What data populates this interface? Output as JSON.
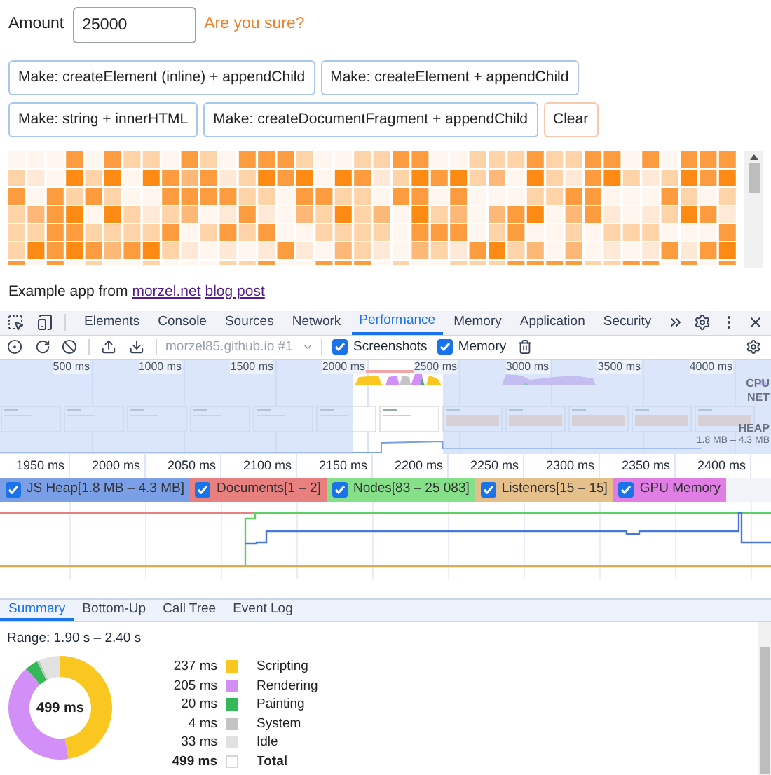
{
  "page": {
    "amount_label": "Amount",
    "amount_value": "25000",
    "warning": "Are you sure?",
    "buttons": [
      {
        "label": "Make: createElement (inline) + appendChild",
        "kind": "make"
      },
      {
        "label": "Make: createElement + appendChild",
        "kind": "make"
      },
      {
        "label": "Make: string + innerHTML",
        "kind": "make"
      },
      {
        "label": "Make: createDocumentFragment + appendChild",
        "kind": "make"
      },
      {
        "label": "Clear",
        "kind": "clear"
      }
    ],
    "footer": {
      "text": "Example app from",
      "links": [
        "morzel.net",
        "blog post"
      ]
    }
  },
  "devtools": {
    "tabs": [
      {
        "label": "Elements",
        "selected": false
      },
      {
        "label": "Console",
        "selected": false
      },
      {
        "label": "Sources",
        "selected": false
      },
      {
        "label": "Network",
        "selected": false
      },
      {
        "label": "Performance",
        "selected": true
      },
      {
        "label": "Memory",
        "selected": false
      },
      {
        "label": "Application",
        "selected": false
      },
      {
        "label": "Security",
        "selected": false
      }
    ],
    "toolbar": {
      "target": "morzel85.github.io #1",
      "checkboxes": [
        {
          "label": "Screenshots",
          "checked": true
        },
        {
          "label": "Memory",
          "checked": true
        }
      ]
    },
    "overview": {
      "ticks": [
        "500 ms",
        "1000 ms",
        "1500 ms",
        "2000 ms",
        "2500 ms",
        "3000 ms",
        "3500 ms",
        "4000 ms"
      ],
      "cpu_label": "CPU",
      "net_label": "NET",
      "heap_label": "HEAP",
      "heap_range": "1.8 MB – 4.3 MB"
    },
    "ruler": {
      "ticks": [
        "1950 ms",
        "2000 ms",
        "2050 ms",
        "2100 ms",
        "2150 ms",
        "2200 ms",
        "2250 ms",
        "2300 ms",
        "2350 ms",
        "2400 ms"
      ]
    },
    "counters": [
      {
        "label": "JS Heap[1.8 MB – 4.3 MB]",
        "checked": true,
        "color": "#7b9fe6"
      },
      {
        "label": "Documents[1 – 2]",
        "checked": true,
        "color": "#e88080"
      },
      {
        "label": "Nodes[83 – 25 083]",
        "checked": true,
        "color": "#86e08a"
      },
      {
        "label": "Listeners[15 – 15]",
        "checked": true,
        "color": "#e6c08a"
      },
      {
        "label": "GPU Memory",
        "checked": true,
        "color": "#e07ee6"
      }
    ],
    "bottom_tabs": [
      {
        "label": "Summary",
        "selected": true
      },
      {
        "label": "Bottom-Up",
        "selected": false
      },
      {
        "label": "Call Tree",
        "selected": false
      },
      {
        "label": "Event Log",
        "selected": false
      }
    ],
    "summary": {
      "range": "Range: 1.90 s – 2.40 s",
      "total": "499 ms",
      "legend": [
        {
          "time": "237 ms",
          "color": "#f9c720"
        },
        {
          "time": "205 ms",
          "color": "#d28ff7"
        },
        {
          "time": "20 ms",
          "color": "#35b858"
        },
        {
          "time": "4 ms",
          "color": "#c4c4c4"
        },
        {
          "time": "33 ms",
          "color": "#e2e2e2"
        }
      ],
      "total_row": {
        "time": "499 ms",
        "label": "Total"
      },
      "chart_data": {
        "type": "donut",
        "categories": [
          "Scripting",
          "Rendering",
          "Painting",
          "System",
          "Idle"
        ],
        "series": [
          {
            "values": [
              47.5,
              41.1,
              4.0,
              0.8,
              6.6
            ]
          }
        ]
      }
    }
  }
}
